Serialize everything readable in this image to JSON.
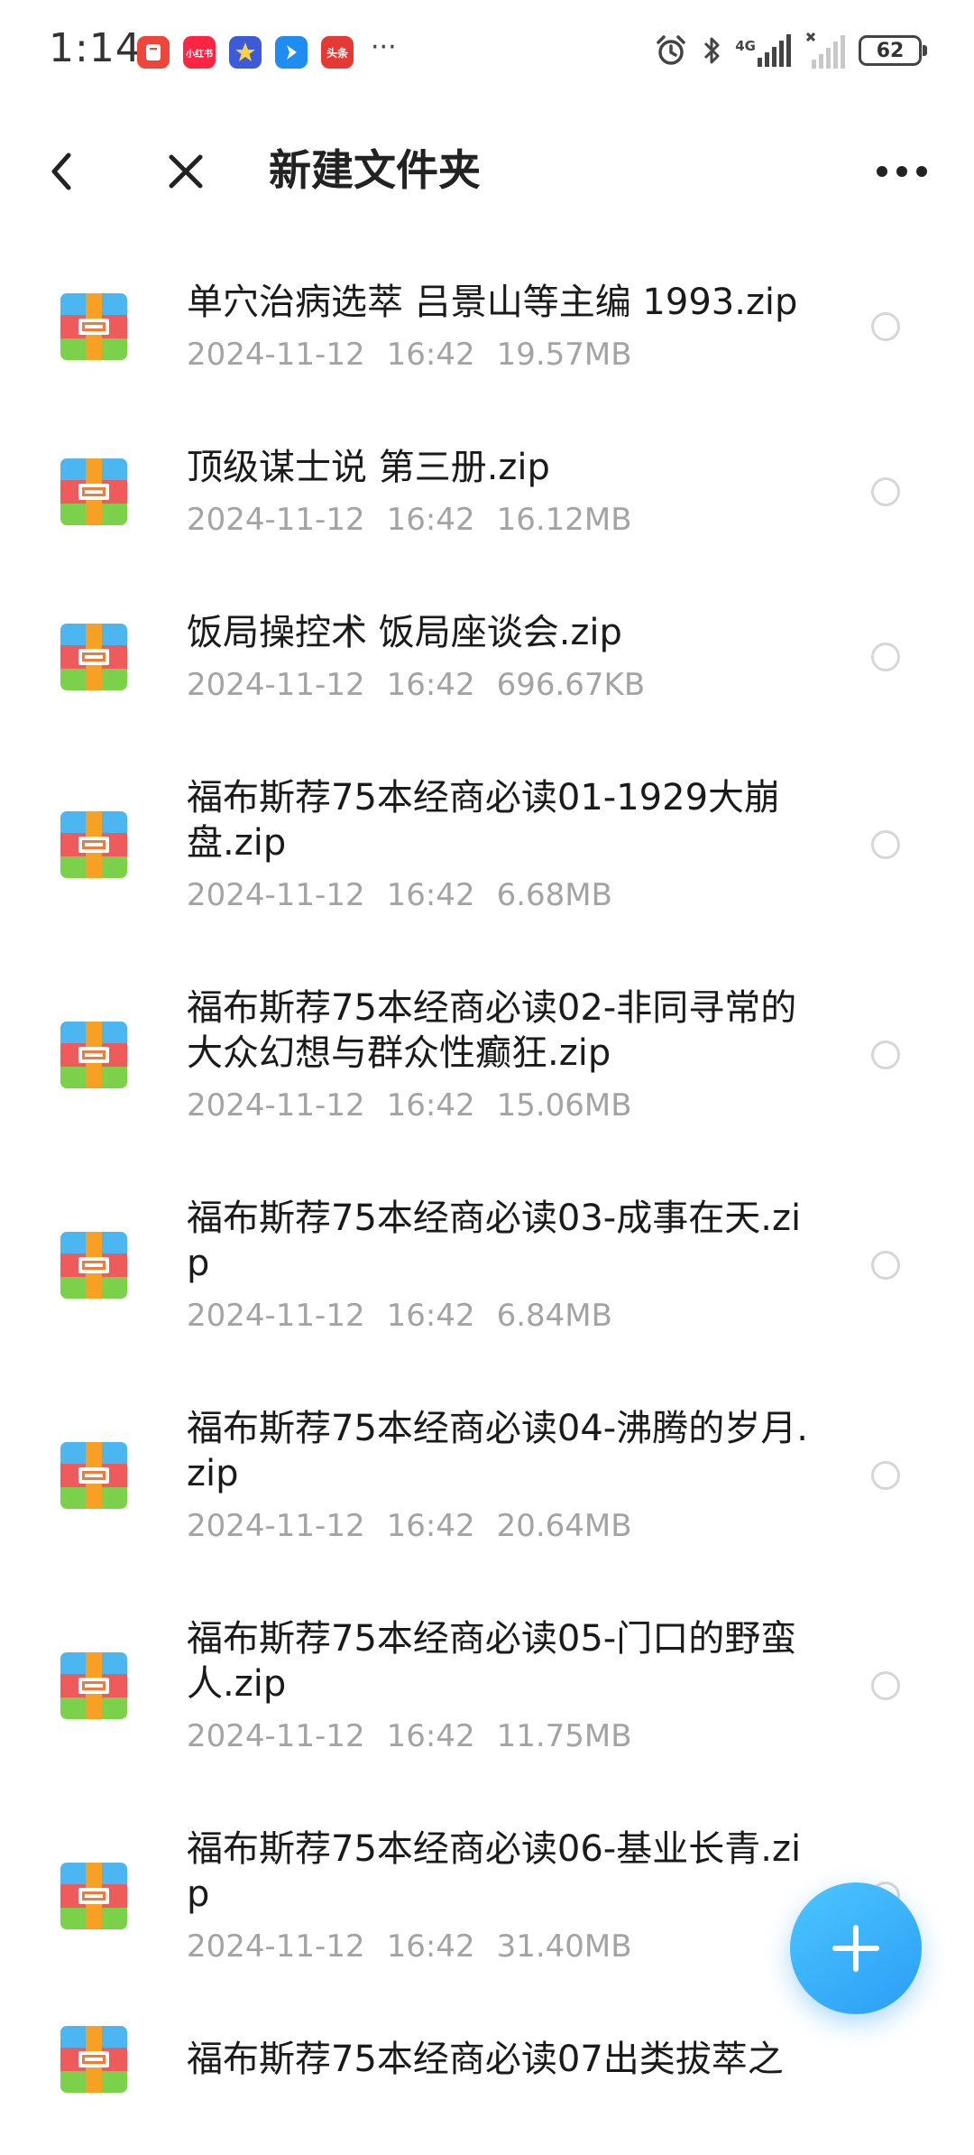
{
  "status_bar": {
    "time": "1:14",
    "network": "4G",
    "battery": "62",
    "apps": [
      {
        "icon": "red-book-app-icon",
        "label": "",
        "color": "#f0453a"
      },
      {
        "icon": "xiaohongshu-app-icon",
        "label": "小红书",
        "color": "#ff2442"
      },
      {
        "icon": "star-app-icon",
        "label": "",
        "color": "#3b5bd9"
      },
      {
        "icon": "arrow-app-icon",
        "label": "",
        "color": "#1e8cf0"
      },
      {
        "icon": "toutiao-app-icon",
        "label": "头条",
        "color": "#e53935"
      }
    ],
    "more": "···"
  },
  "header": {
    "title": "新建文件夹",
    "back_icon": "chevron-left-icon",
    "close_icon": "close-icon",
    "more_icon": "more-horizontal-icon"
  },
  "files": [
    {
      "name": "单穴治病选萃 吕景山等主编 1993.zip",
      "date": "2024-11-12",
      "time": "16:42",
      "size": "19.57MB"
    },
    {
      "name": "顶级谋士说 第三册.zip",
      "date": "2024-11-12",
      "time": "16:42",
      "size": "16.12MB"
    },
    {
      "name": "饭局操控术 饭局座谈会.zip",
      "date": "2024-11-12",
      "time": "16:42",
      "size": "696.67KB"
    },
    {
      "name": "福布斯荐75本经商必读01-1929大崩盘.zip",
      "date": "2024-11-12",
      "time": "16:42",
      "size": "6.68MB"
    },
    {
      "name": "福布斯荐75本经商必读02-非同寻常的大众幻想与群众性癫狂.zip",
      "date": "2024-11-12",
      "time": "16:42",
      "size": "15.06MB"
    },
    {
      "name": "福布斯荐75本经商必读03-成事在天.zip",
      "date": "2024-11-12",
      "time": "16:42",
      "size": "6.84MB"
    },
    {
      "name": "福布斯荐75本经商必读04-沸腾的岁月.zip",
      "date": "2024-11-12",
      "time": "16:42",
      "size": "20.64MB"
    },
    {
      "name": "福布斯荐75本经商必读05-门口的野蛮人.zip",
      "date": "2024-11-12",
      "time": "16:42",
      "size": "11.75MB"
    },
    {
      "name": "福布斯荐75本经商必读06-基业长青.zip",
      "date": "2024-11-12",
      "time": "16:42",
      "size": "31.40MB"
    },
    {
      "name": "福布斯荐75本经商必读07出类拔萃之",
      "date": "",
      "time": "",
      "size": ""
    }
  ],
  "fab": {
    "icon": "plus-icon",
    "color": "#2a9ef5"
  },
  "colors": {
    "accent": "#2a9ef5",
    "text_primary": "#1a1a1a",
    "text_secondary": "#a3a3a3"
  }
}
